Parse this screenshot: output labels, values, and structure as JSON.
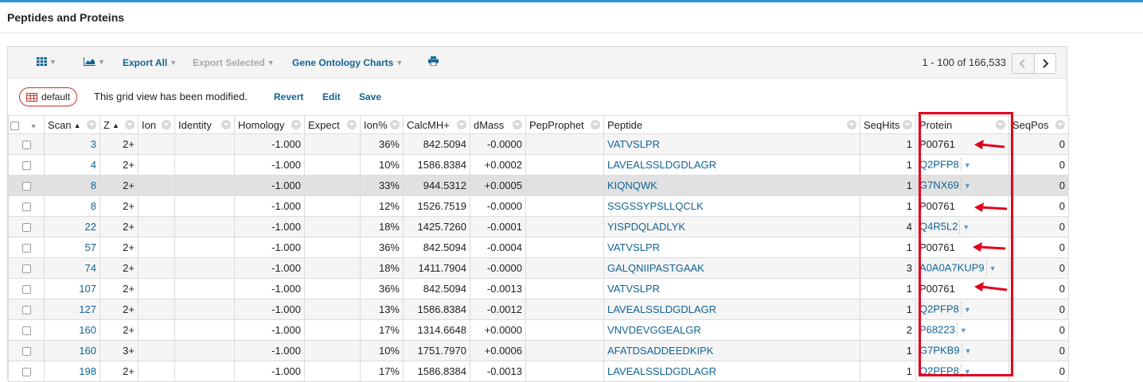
{
  "page": {
    "title": "Peptides and Proteins"
  },
  "toolbar": {
    "grid_icon": "grid-icon",
    "chart_icon": "area-chart-icon",
    "export_all": "Export All",
    "export_selected": "Export Selected",
    "go_charts": "Gene Ontology Charts",
    "print_icon": "print-icon",
    "paging": "1 - 100 of 166,533"
  },
  "viewbar": {
    "view_name": "default",
    "message": "This grid view has been modified.",
    "revert": "Revert",
    "edit": "Edit",
    "save": "Save"
  },
  "columns": [
    "Scan",
    "Z",
    "Ion",
    "Identity",
    "Homology",
    "Expect",
    "Ion%",
    "CalcMH+",
    "dMass",
    "PepProphet",
    "Peptide",
    "SeqHits",
    "Protein",
    "SeqPos"
  ],
  "rows": [
    {
      "scan": "3",
      "z": "2+",
      "homology": "-1.000",
      "ionpct": "36%",
      "calcmh": "842.5094",
      "dmass": "-0.0000",
      "peptide": "VATVSLPR",
      "seqhits": "1",
      "protein": "P00761",
      "seqpos": "0"
    },
    {
      "scan": "4",
      "z": "2+",
      "homology": "-1.000",
      "ionpct": "10%",
      "calcmh": "1586.8384",
      "dmass": "+0.0002",
      "peptide": "LAVEALSSLDGDLAGR",
      "seqhits": "1",
      "protein": "Q2PFP8",
      "seqpos": "0"
    },
    {
      "scan": "8",
      "z": "2+",
      "homology": "-1.000",
      "ionpct": "33%",
      "calcmh": "944.5312",
      "dmass": "+0.0005",
      "peptide": "KIQNQWK",
      "seqhits": "1",
      "protein": "G7NX69",
      "seqpos": "0"
    },
    {
      "scan": "8",
      "z": "2+",
      "homology": "-1.000",
      "ionpct": "12%",
      "calcmh": "1526.7519",
      "dmass": "-0.0000",
      "peptide": "SSGSSYPSLLQCLK",
      "seqhits": "1",
      "protein": "P00761",
      "seqpos": "0"
    },
    {
      "scan": "22",
      "z": "2+",
      "homology": "-1.000",
      "ionpct": "18%",
      "calcmh": "1425.7260",
      "dmass": "-0.0001",
      "peptide": "YISPDQLADLYK",
      "seqhits": "4",
      "protein": "Q4R5L2",
      "seqpos": "0"
    },
    {
      "scan": "57",
      "z": "2+",
      "homology": "-1.000",
      "ionpct": "36%",
      "calcmh": "842.5094",
      "dmass": "-0.0004",
      "peptide": "VATVSLPR",
      "seqhits": "1",
      "protein": "P00761",
      "seqpos": "0"
    },
    {
      "scan": "74",
      "z": "2+",
      "homology": "-1.000",
      "ionpct": "18%",
      "calcmh": "1411.7904",
      "dmass": "-0.0000",
      "peptide": "GALQNIIPASTGAAK",
      "seqhits": "3",
      "protein": "A0A0A7KUP9",
      "seqpos": "0"
    },
    {
      "scan": "107",
      "z": "2+",
      "homology": "-1.000",
      "ionpct": "36%",
      "calcmh": "842.5094",
      "dmass": "-0.0013",
      "peptide": "VATVSLPR",
      "seqhits": "1",
      "protein": "P00761",
      "seqpos": "0"
    },
    {
      "scan": "127",
      "z": "2+",
      "homology": "-1.000",
      "ionpct": "13%",
      "calcmh": "1586.8384",
      "dmass": "-0.0012",
      "peptide": "LAVEALSSLDGDLAGR",
      "seqhits": "1",
      "protein": "Q2PFP8",
      "seqpos": "0"
    },
    {
      "scan": "160",
      "z": "2+",
      "homology": "-1.000",
      "ionpct": "17%",
      "calcmh": "1314.6648",
      "dmass": "+0.0000",
      "peptide": "VNVDEVGGEALGR",
      "seqhits": "2",
      "protein": "P68223",
      "seqpos": "0"
    },
    {
      "scan": "160",
      "z": "3+",
      "homology": "-1.000",
      "ionpct": "10%",
      "calcmh": "1751.7970",
      "dmass": "+0.0006",
      "peptide": "AFATDSADDEEDKIPK",
      "seqhits": "1",
      "protein": "G7PKB9",
      "seqpos": "0"
    },
    {
      "scan": "198",
      "z": "2+",
      "homology": "-1.000",
      "ionpct": "17%",
      "calcmh": "1586.8384",
      "dmass": "-0.0013",
      "peptide": "LAVEALSSLDGDLAGR",
      "seqhits": "1",
      "protein": "Q2PFP8",
      "seqpos": "0"
    }
  ],
  "colors": {
    "link": "#126495",
    "annotation": "#e2001a",
    "top_border": "#3495d2"
  }
}
